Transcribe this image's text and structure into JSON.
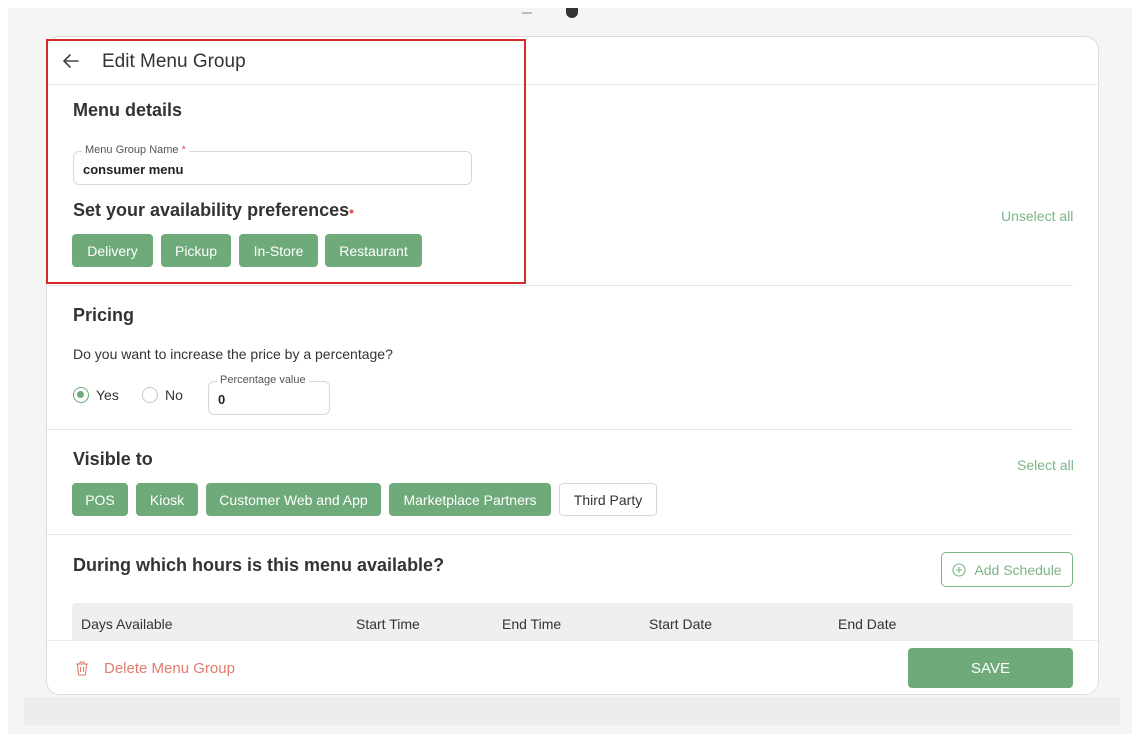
{
  "header": {
    "title": "Edit Menu Group"
  },
  "menu_details": {
    "title": "Menu details",
    "name_field": {
      "label": "Menu Group Name",
      "required_mark": "*",
      "value": "consumer menu"
    }
  },
  "availability": {
    "title": "Set your availability preferences",
    "required_mark": "•",
    "toggle_all_label": "Unselect all",
    "options": [
      {
        "label": "Delivery",
        "selected": true
      },
      {
        "label": "Pickup",
        "selected": true
      },
      {
        "label": "In-Store",
        "selected": true
      },
      {
        "label": "Restaurant",
        "selected": true
      }
    ]
  },
  "pricing": {
    "title": "Pricing",
    "question": "Do you want to increase the price by a percentage?",
    "yes_label": "Yes",
    "no_label": "No",
    "selected": "Yes",
    "percentage_field": {
      "label": "Percentage value",
      "value": "0"
    }
  },
  "visible_to": {
    "title": "Visible to",
    "toggle_all_label": "Select all",
    "options": [
      {
        "label": "POS",
        "selected": true
      },
      {
        "label": "Kiosk",
        "selected": true
      },
      {
        "label": "Customer Web and App",
        "selected": true
      },
      {
        "label": "Marketplace Partners",
        "selected": true
      },
      {
        "label": "Third Party",
        "selected": false
      }
    ]
  },
  "schedule": {
    "title": "During which hours is this menu available?",
    "add_label": "Add Schedule",
    "columns": [
      "Days Available",
      "Start Time",
      "End Time",
      "Start Date",
      "End Date"
    ]
  },
  "footer": {
    "delete_label": "Delete Menu Group",
    "save_label": "SAVE"
  },
  "colors": {
    "accent": "#6faa7a",
    "danger": "#e27b6e",
    "highlight": "#d42a2a"
  },
  "icons": {
    "back": "arrow-left-icon",
    "add": "plus-circle-icon",
    "delete": "trash-icon"
  }
}
